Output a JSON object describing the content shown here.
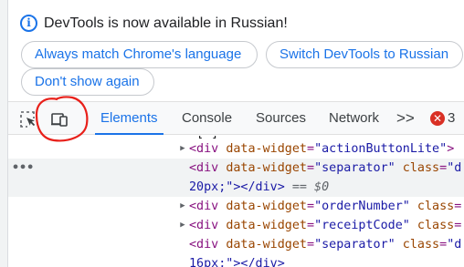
{
  "infobar": {
    "icon": "info-icon",
    "message": "DevTools is now available in Russian!",
    "buttons": {
      "match_language": "Always match Chrome's language",
      "switch_language": "Switch DevTools to Russian",
      "dont_show": "Don't show again"
    }
  },
  "toolbar": {
    "tabs": {
      "elements": "Elements",
      "console": "Console",
      "sources": "Sources",
      "network": "Network"
    },
    "more_tabs": ">>",
    "error_badge_symbol": "✕",
    "error_count": "3",
    "annotation_color": "#e8201a"
  },
  "code": {
    "fragment_top": "[ ]",
    "lines": [
      {
        "tag_open": "<div ",
        "attr": "data-widget",
        "eq": "=",
        "value": "\"actionButtonLite\"",
        "rest": ">"
      },
      {
        "tag_open": "<div ",
        "attr": "data-widget",
        "eq": "=",
        "value": "\"separator\"",
        "attr2": " class",
        "eq2": "=",
        "value2": "\"d"
      },
      {
        "continuation": "20px;\"></div>",
        "ref": " == $0"
      },
      {
        "tag_open": "<div ",
        "attr": "data-widget",
        "eq": "=",
        "value": "\"orderNumber\"",
        "attr2": " class",
        "eq2": "="
      },
      {
        "tag_open": "<div ",
        "attr": "data-widget",
        "eq": "=",
        "value": "\"receiptCode\"",
        "attr2": " class",
        "eq2": "="
      },
      {
        "tag_open": "<div ",
        "attr": "data-widget",
        "eq": "=",
        "value": "\"separator\"",
        "attr2": " class",
        "eq2": "=",
        "value2": "\"d"
      },
      {
        "continuation": "16px;\"></div>"
      }
    ]
  }
}
